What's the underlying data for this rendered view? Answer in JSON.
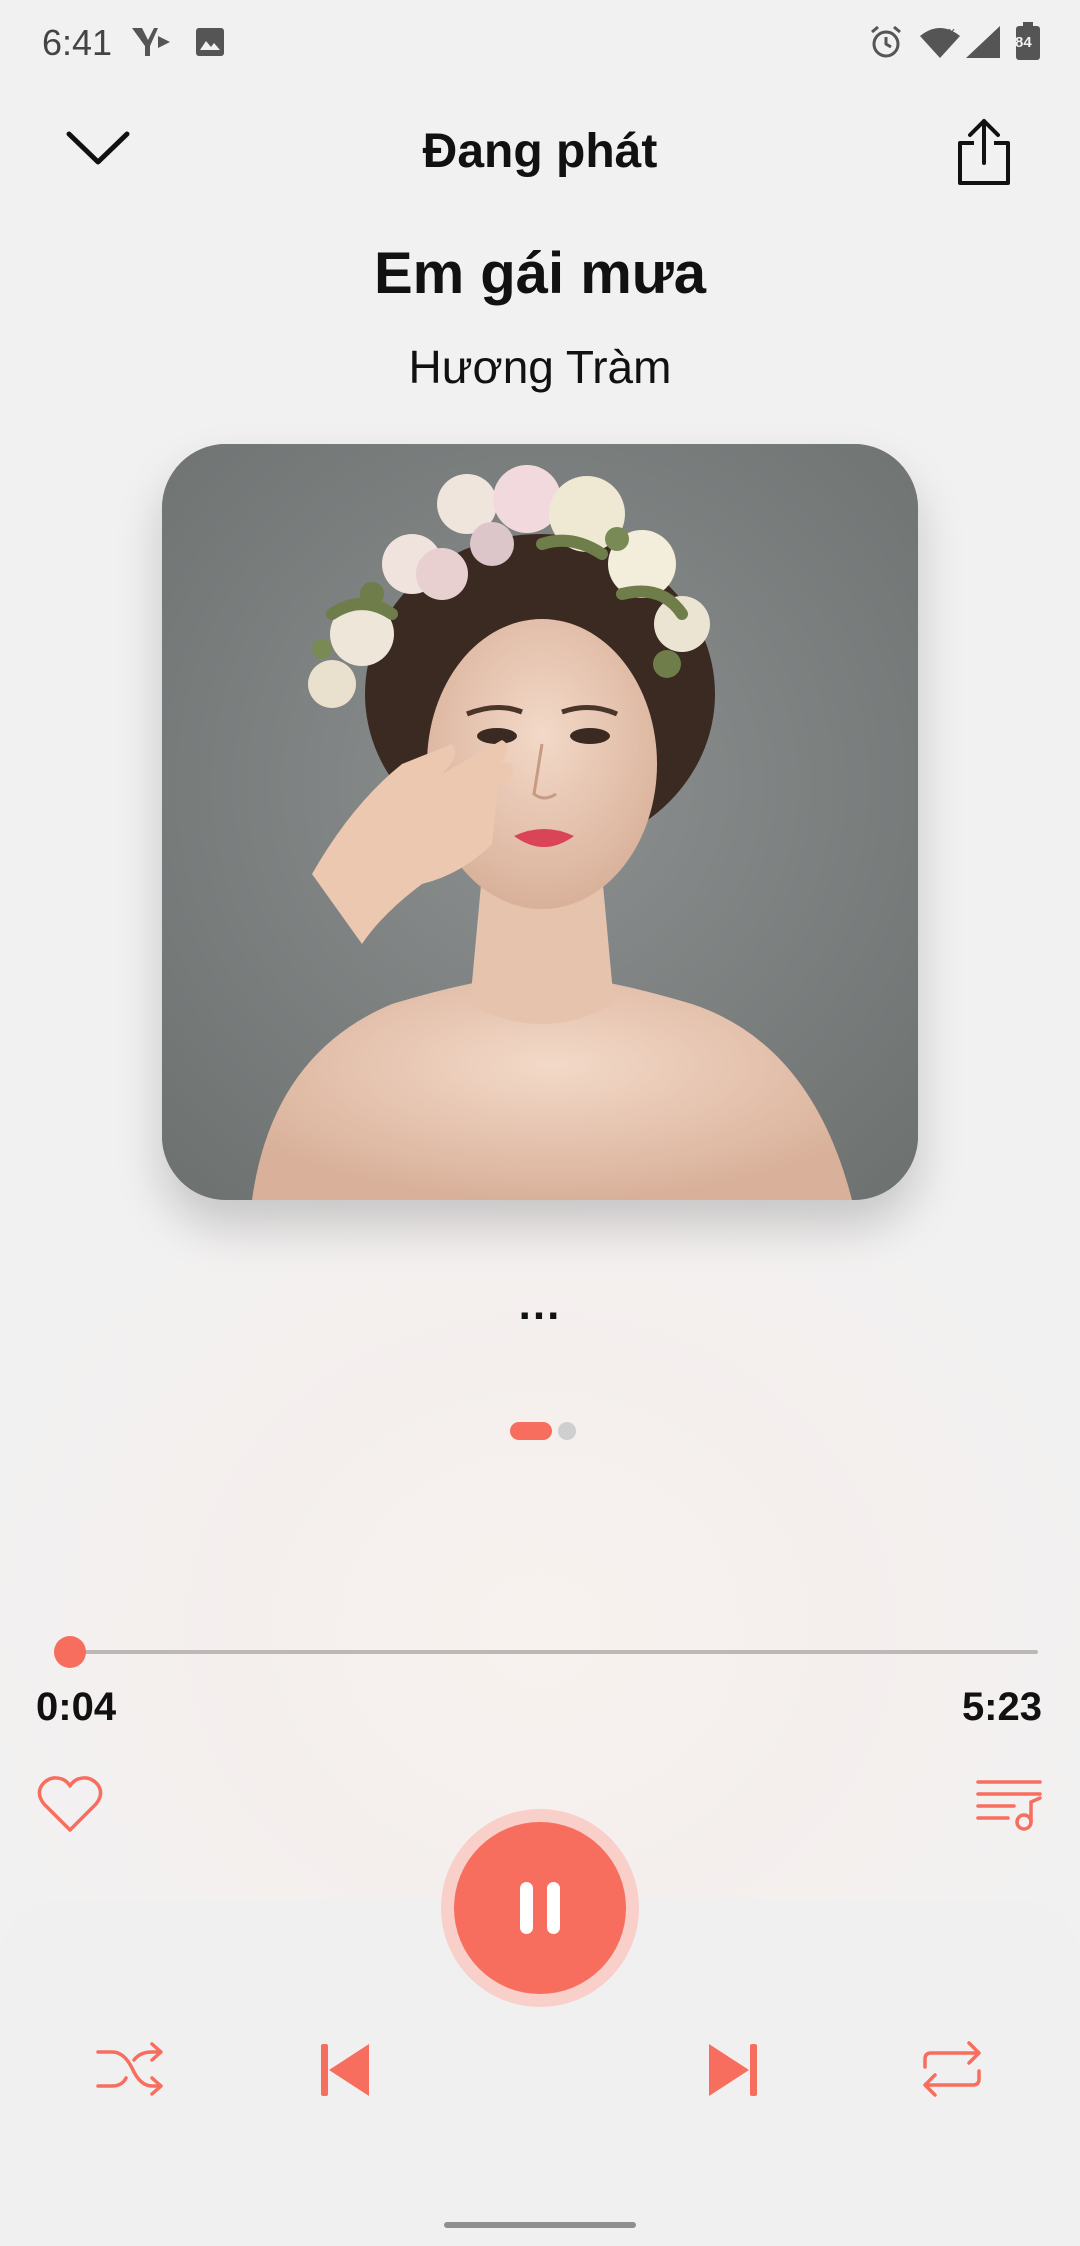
{
  "status_bar": {
    "time": "6:41",
    "battery": "84",
    "icons": [
      "app-notification-icon",
      "image-icon",
      "alarm-icon",
      "wifi-icon",
      "signal-icon",
      "battery-icon"
    ]
  },
  "header": {
    "title": "Đang phát",
    "left_icon": "chevron-down-icon",
    "right_icon": "share-icon"
  },
  "song": {
    "title": "Em gái mưa",
    "artist": "Hương Tràm"
  },
  "lyrics": {
    "text": "..."
  },
  "pager": {
    "page_count": 2,
    "active_page": 1
  },
  "progress": {
    "current": "0:04",
    "total": "5:23",
    "fraction": 0.012
  },
  "actions": {
    "favorite_icon": "heart-icon",
    "playlist_icon": "playlist-icon"
  },
  "controls": {
    "shuffle_icon": "shuffle-icon",
    "previous_icon": "previous-icon",
    "pause_icon": "pause-icon",
    "next_icon": "next-icon",
    "repeat_icon": "repeat-icon"
  },
  "colors": {
    "accent": "#f76e5f",
    "accent_light": "#f8cfc9",
    "background": "#f2f1f1",
    "text": "#111111"
  }
}
